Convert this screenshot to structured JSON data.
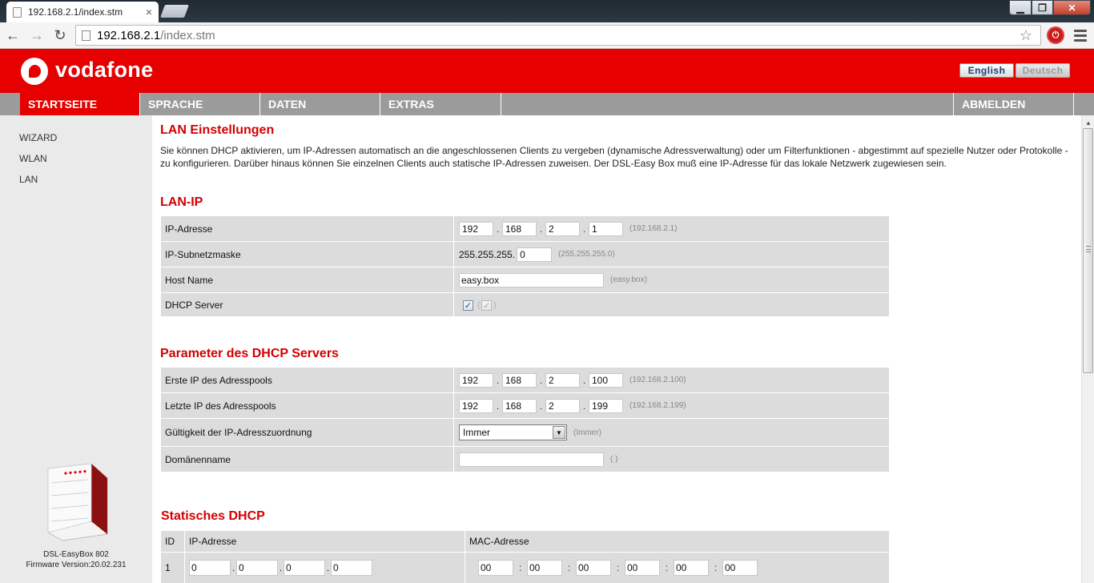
{
  "browser": {
    "tab_title": "192.168.2.1/index.stm",
    "tab_close": "×",
    "url_host": "192.168.2.1",
    "url_path": "/index.stm",
    "min_glyph": "▁",
    "max_glyph": "❐",
    "close_glyph": "✕",
    "back_glyph": "←",
    "fwd_glyph": "→",
    "reload_glyph": "↻",
    "star_glyph": "☆",
    "ext_glyph": "⏻"
  },
  "brand": {
    "logo_text": "vodafone",
    "accent": "#e60000",
    "lang_english": "English",
    "lang_deutsch": "Deutsch"
  },
  "mainnav": {
    "startseite": "STARTSEITE",
    "sprache": "SPRACHE",
    "daten": "DATEN",
    "extras": "EXTRAS",
    "abmelden": "ABMELDEN"
  },
  "sidebar": {
    "items": [
      "WIZARD",
      "WLAN",
      "LAN"
    ],
    "device_name": "DSL-EasyBox 802",
    "firmware": "Firmware Version:20.02.231"
  },
  "lan": {
    "title": "LAN Einstellungen",
    "intro": "Sie können DHCP aktivieren, um IP-Adressen automatisch an die angeschlossenen Clients zu vergeben (dynamische Adressverwaltung) oder um Filterfunktionen - abgestimmt auf spezielle Nutzer oder Protokolle - zu konfigurieren. Darüber hinaus können Sie einzelnen Clients auch statische IP-Adressen zuweisen. Der DSL-Easy Box muß eine IP-Adresse für das lokale Netzwerk zugewiesen sein."
  },
  "lanip": {
    "title": "LAN-IP",
    "ip_label": "IP-Adresse",
    "ip_octets": [
      "192",
      "168",
      "2",
      "1"
    ],
    "ip_hint": "(192.168.2.1)",
    "mask_label": "IP-Subnetzmaske",
    "mask_prefix": "255.255.255.",
    "mask_last": "0",
    "mask_hint": "(255.255.255.0)",
    "host_label": "Host Name",
    "host_value": "easy.box",
    "host_hint": "(easy.box)",
    "dhcp_label": "DHCP Server",
    "dhcp_checked": true,
    "check_glyph": "✓",
    "hint_open": "(",
    "hint_close": ")"
  },
  "dhcp": {
    "title": "Parameter des DHCP Servers",
    "first_label": "Erste IP des Adresspools",
    "first_octets": [
      "192",
      "168",
      "2",
      "100"
    ],
    "first_hint": "(192.168.2.100)",
    "last_label": "Letzte IP des Adresspools",
    "last_octets": [
      "192",
      "168",
      "2",
      "199"
    ],
    "last_hint": "(192.168.2.199)",
    "lease_label": "Gültigkeit der IP-Adresszuordnung",
    "lease_value": "Immer",
    "lease_hint": "(Immer)",
    "lease_arrow": "▼",
    "domain_label": "Domänenname",
    "domain_value": "",
    "domain_hint": "( )"
  },
  "static": {
    "title": "Statisches DHCP",
    "col_id": "ID",
    "col_ip": "IP-Adresse",
    "col_mac": "MAC-Adresse",
    "row_id": "1",
    "ip_octets": [
      "0",
      "0",
      "0",
      "0"
    ],
    "mac_octets": [
      "00",
      "00",
      "00",
      "00",
      "00",
      "00"
    ]
  },
  "scrollbar": {
    "up_glyph": "▲"
  }
}
